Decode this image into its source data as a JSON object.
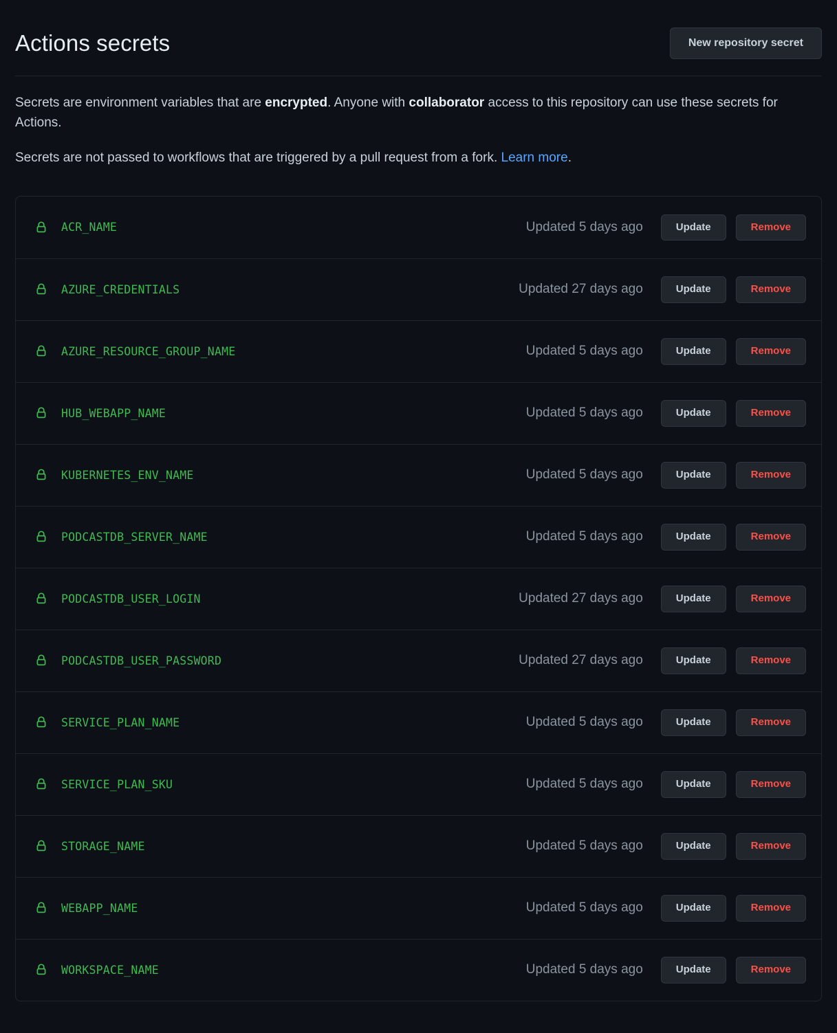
{
  "header": {
    "title": "Actions secrets",
    "new_secret_button": "New repository secret"
  },
  "intro": {
    "line1_part1": "Secrets are environment variables that are ",
    "line1_bold1": "encrypted",
    "line1_part2": ". Anyone with ",
    "line1_bold2": "collaborator",
    "line1_part3": " access to this repository can use these secrets for Actions.",
    "line2_part1": "Secrets are not passed to workflows that are triggered by a pull request from a fork. ",
    "line2_link": "Learn more",
    "line2_part2": "."
  },
  "row_actions": {
    "update_label": "Update",
    "remove_label": "Remove"
  },
  "icons": {
    "lock": "lock-icon"
  },
  "colors": {
    "page_background": "#0d1117",
    "secret_name": "#3fb950",
    "link": "#58a6ff",
    "remove": "#f85149",
    "muted_text": "#8b949e",
    "border": "#21262d",
    "button_background": "#21262d",
    "button_border": "#30363d"
  },
  "secrets": [
    {
      "name": "ACR_NAME",
      "updated": "Updated 5 days ago"
    },
    {
      "name": "AZURE_CREDENTIALS",
      "updated": "Updated 27 days ago"
    },
    {
      "name": "AZURE_RESOURCE_GROUP_NAME",
      "updated": "Updated 5 days ago"
    },
    {
      "name": "HUB_WEBAPP_NAME",
      "updated": "Updated 5 days ago"
    },
    {
      "name": "KUBERNETES_ENV_NAME",
      "updated": "Updated 5 days ago"
    },
    {
      "name": "PODCASTDB_SERVER_NAME",
      "updated": "Updated 5 days ago"
    },
    {
      "name": "PODCASTDB_USER_LOGIN",
      "updated": "Updated 27 days ago"
    },
    {
      "name": "PODCASTDB_USER_PASSWORD",
      "updated": "Updated 27 days ago"
    },
    {
      "name": "SERVICE_PLAN_NAME",
      "updated": "Updated 5 days ago"
    },
    {
      "name": "SERVICE_PLAN_SKU",
      "updated": "Updated 5 days ago"
    },
    {
      "name": "STORAGE_NAME",
      "updated": "Updated 5 days ago"
    },
    {
      "name": "WEBAPP_NAME",
      "updated": "Updated 5 days ago"
    },
    {
      "name": "WORKSPACE_NAME",
      "updated": "Updated 5 days ago"
    }
  ]
}
